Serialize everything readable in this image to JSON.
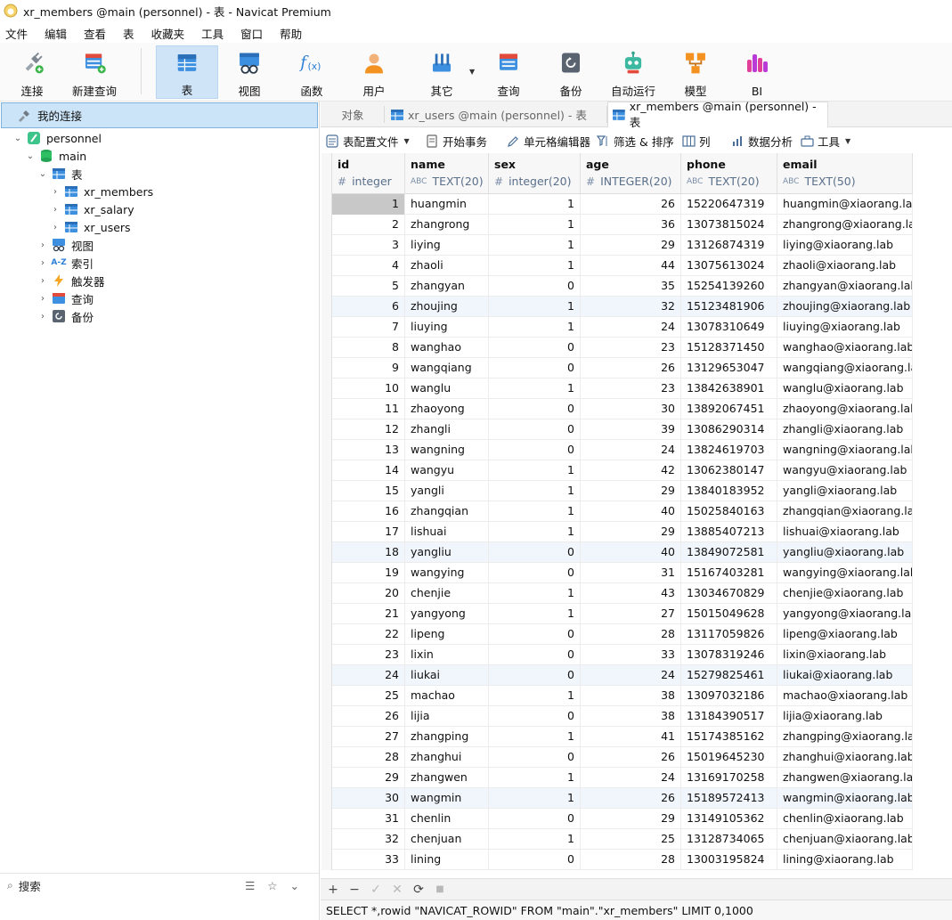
{
  "window": {
    "title": "xr_members @main (personnel) - 表 - Navicat Premium"
  },
  "menu": [
    "文件",
    "编辑",
    "查看",
    "表",
    "收藏夹",
    "工具",
    "窗口",
    "帮助"
  ],
  "toolbar": {
    "connect": "连接",
    "new_query": "新建查询",
    "table": "表",
    "view": "视图",
    "function": "函数",
    "user": "用户",
    "other": "其它",
    "query": "查询",
    "backup": "备份",
    "automation": "自动运行",
    "model": "模型",
    "bi": "BI"
  },
  "sidebar": {
    "header": "我的连接",
    "connection": "personnel",
    "database": "main",
    "tables_folder": "表",
    "tables": [
      "xr_members",
      "xr_salary",
      "xr_users"
    ],
    "views": "视图",
    "indexes": "索引",
    "triggers": "触发器",
    "queries": "查询",
    "backups": "备份",
    "search_label": "搜索"
  },
  "tabs": {
    "objects": "对象",
    "tab1": "xr_users @main (personnel) - 表",
    "tab2": "xr_members @main (personnel) - 表"
  },
  "subtoolbar": {
    "table_profile": "表配置文件",
    "begin_transaction": "开始事务",
    "cell_editor": "单元格编辑器",
    "filter_sort": "筛选 & 排序",
    "columns": "列",
    "data_analysis": "数据分析",
    "tools": "工具"
  },
  "columns": [
    {
      "name": "id",
      "type": "integer",
      "type_icon": "#"
    },
    {
      "name": "name",
      "type": "TEXT(20)",
      "type_icon": "ABC"
    },
    {
      "name": "sex",
      "type": "integer(20)",
      "type_icon": "#"
    },
    {
      "name": "age",
      "type": "INTEGER(20)",
      "type_icon": "#"
    },
    {
      "name": "phone",
      "type": "TEXT(20)",
      "type_icon": "ABC"
    },
    {
      "name": "email",
      "type": "TEXT(50)",
      "type_icon": "ABC"
    }
  ],
  "rows": [
    [
      "1",
      "huangmin",
      "1",
      "26",
      "15220647319",
      "huangmin@xiaorang.lab"
    ],
    [
      "2",
      "zhangrong",
      "1",
      "36",
      "13073815024",
      "zhangrong@xiaorang.la"
    ],
    [
      "3",
      "liying",
      "1",
      "29",
      "13126874319",
      "liying@xiaorang.lab"
    ],
    [
      "4",
      "zhaoli",
      "1",
      "44",
      "13075613024",
      "zhaoli@xiaorang.lab"
    ],
    [
      "5",
      "zhangyan",
      "0",
      "35",
      "15254139260",
      "zhangyan@xiaorang.lab"
    ],
    [
      "6",
      "zhoujing",
      "1",
      "32",
      "15123481906",
      "zhoujing@xiaorang.lab"
    ],
    [
      "7",
      "liuying",
      "1",
      "24",
      "13078310649",
      "liuying@xiaorang.lab"
    ],
    [
      "8",
      "wanghao",
      "0",
      "23",
      "15128371450",
      "wanghao@xiaorang.lab"
    ],
    [
      "9",
      "wangqiang",
      "0",
      "26",
      "13129653047",
      "wangqiang@xiaorang.la"
    ],
    [
      "10",
      "wanglu",
      "1",
      "23",
      "13842638901",
      "wanglu@xiaorang.lab"
    ],
    [
      "11",
      "zhaoyong",
      "0",
      "30",
      "13892067451",
      "zhaoyong@xiaorang.lab"
    ],
    [
      "12",
      "zhangli",
      "0",
      "39",
      "13086290314",
      "zhangli@xiaorang.lab"
    ],
    [
      "13",
      "wangning",
      "0",
      "24",
      "13824619703",
      "wangning@xiaorang.lab"
    ],
    [
      "14",
      "wangyu",
      "1",
      "42",
      "13062380147",
      "wangyu@xiaorang.lab"
    ],
    [
      "15",
      "yangli",
      "1",
      "29",
      "13840183952",
      "yangli@xiaorang.lab"
    ],
    [
      "16",
      "zhangqian",
      "1",
      "40",
      "15025840163",
      "zhangqian@xiaorang.lab"
    ],
    [
      "17",
      "lishuai",
      "1",
      "29",
      "13885407213",
      "lishuai@xiaorang.lab"
    ],
    [
      "18",
      "yangliu",
      "0",
      "40",
      "13849072581",
      "yangliu@xiaorang.lab"
    ],
    [
      "19",
      "wangying",
      "0",
      "31",
      "15167403281",
      "wangying@xiaorang.lab"
    ],
    [
      "20",
      "chenjie",
      "1",
      "43",
      "13034670829",
      "chenjie@xiaorang.lab"
    ],
    [
      "21",
      "yangyong",
      "1",
      "27",
      "15015049628",
      "yangyong@xiaorang.lab"
    ],
    [
      "22",
      "lipeng",
      "0",
      "28",
      "13117059826",
      "lipeng@xiaorang.lab"
    ],
    [
      "23",
      "lixin",
      "0",
      "33",
      "13078319246",
      "lixin@xiaorang.lab"
    ],
    [
      "24",
      "liukai",
      "0",
      "24",
      "15279825461",
      "liukai@xiaorang.lab"
    ],
    [
      "25",
      "machao",
      "1",
      "38",
      "13097032186",
      "machao@xiaorang.lab"
    ],
    [
      "26",
      "lijia",
      "0",
      "38",
      "13184390517",
      "lijia@xiaorang.lab"
    ],
    [
      "27",
      "zhangping",
      "1",
      "41",
      "15174385162",
      "zhangping@xiaorang.lab"
    ],
    [
      "28",
      "zhanghui",
      "0",
      "26",
      "15019645230",
      "zhanghui@xiaorang.lab"
    ],
    [
      "29",
      "zhangwen",
      "1",
      "24",
      "13169170258",
      "zhangwen@xiaorang.lab"
    ],
    [
      "30",
      "wangmin",
      "1",
      "26",
      "15189572413",
      "wangmin@xiaorang.lab"
    ],
    [
      "31",
      "chenlin",
      "0",
      "29",
      "13149105362",
      "chenlin@xiaorang.lab"
    ],
    [
      "32",
      "chenjuan",
      "1",
      "25",
      "13128734065",
      "chenjuan@xiaorang.lab"
    ],
    [
      "33",
      "lining",
      "0",
      "28",
      "13003195824",
      "lining@xiaorang.lab"
    ]
  ],
  "status_sql": "SELECT *,rowid \"NAVICAT_ROWID\" FROM \"main\".\"xr_members\" LIMIT 0,1000",
  "bottom_buttons": [
    "+",
    "−",
    "✓",
    "✕",
    "⟳",
    "■"
  ]
}
